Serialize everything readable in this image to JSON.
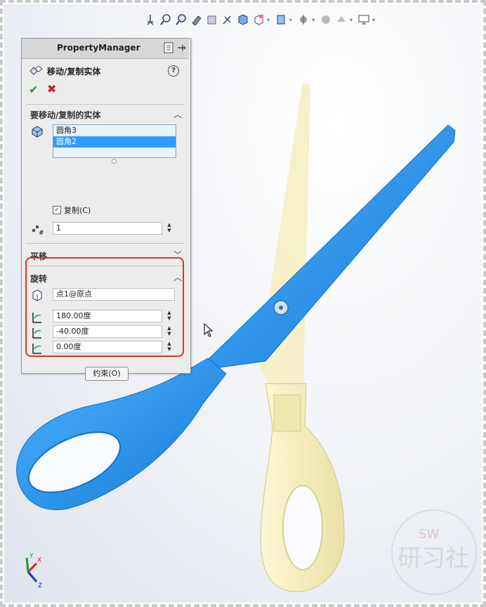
{
  "toolbar": {
    "icons": [
      "standard-views-icon",
      "zoom-to-fit-icon",
      "zoom-to-area-icon",
      "previous-view-icon",
      "section-view-icon",
      "dynamic-annotation-icon",
      "view-orientation-icon",
      "display-style-icon",
      "hide-show-items-icon",
      "edit-appearance-icon",
      "apply-scene-icon",
      "view-settings-icon",
      "display-icon"
    ]
  },
  "property_manager": {
    "tab_title": "PropertyManager",
    "command_title": "移动/复制实体",
    "help_label": "?",
    "bodies_section": {
      "title": "要移动/复制的实体",
      "items": [
        {
          "label": "圆角3",
          "selected": false
        },
        {
          "label": "圆角2",
          "selected": true
        }
      ],
      "copy_label": "复制(C)",
      "copy_checked": true,
      "copies_value": "1"
    },
    "translate_section": {
      "title": "平移"
    },
    "rotate_section": {
      "title": "旋转",
      "point_value": "点1@原点",
      "rot_x": "180.00度",
      "rot_y": "-40.00度",
      "rot_z": "0.00度"
    },
    "constraints_button": "约束(O)"
  },
  "triad": {
    "x": "X",
    "y": "Y",
    "z": "Z"
  },
  "colors": {
    "blue_part": "#1e90e8",
    "yellow_part": "#f3efc0",
    "highlight": "#e03030"
  }
}
